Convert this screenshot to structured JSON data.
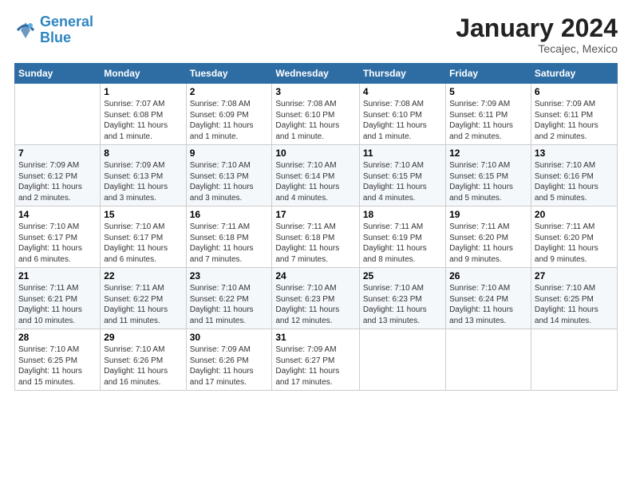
{
  "header": {
    "logo_line1": "General",
    "logo_line2": "Blue",
    "month_title": "January 2024",
    "location": "Tecajec, Mexico"
  },
  "weekdays": [
    "Sunday",
    "Monday",
    "Tuesday",
    "Wednesday",
    "Thursday",
    "Friday",
    "Saturday"
  ],
  "weeks": [
    [
      {
        "day": "",
        "info": ""
      },
      {
        "day": "1",
        "info": "Sunrise: 7:07 AM\nSunset: 6:08 PM\nDaylight: 11 hours\nand 1 minute."
      },
      {
        "day": "2",
        "info": "Sunrise: 7:08 AM\nSunset: 6:09 PM\nDaylight: 11 hours\nand 1 minute."
      },
      {
        "day": "3",
        "info": "Sunrise: 7:08 AM\nSunset: 6:10 PM\nDaylight: 11 hours\nand 1 minute."
      },
      {
        "day": "4",
        "info": "Sunrise: 7:08 AM\nSunset: 6:10 PM\nDaylight: 11 hours\nand 1 minute."
      },
      {
        "day": "5",
        "info": "Sunrise: 7:09 AM\nSunset: 6:11 PM\nDaylight: 11 hours\nand 2 minutes."
      },
      {
        "day": "6",
        "info": "Sunrise: 7:09 AM\nSunset: 6:11 PM\nDaylight: 11 hours\nand 2 minutes."
      }
    ],
    [
      {
        "day": "7",
        "info": "Sunrise: 7:09 AM\nSunset: 6:12 PM\nDaylight: 11 hours\nand 2 minutes."
      },
      {
        "day": "8",
        "info": "Sunrise: 7:09 AM\nSunset: 6:13 PM\nDaylight: 11 hours\nand 3 minutes."
      },
      {
        "day": "9",
        "info": "Sunrise: 7:10 AM\nSunset: 6:13 PM\nDaylight: 11 hours\nand 3 minutes."
      },
      {
        "day": "10",
        "info": "Sunrise: 7:10 AM\nSunset: 6:14 PM\nDaylight: 11 hours\nand 4 minutes."
      },
      {
        "day": "11",
        "info": "Sunrise: 7:10 AM\nSunset: 6:15 PM\nDaylight: 11 hours\nand 4 minutes."
      },
      {
        "day": "12",
        "info": "Sunrise: 7:10 AM\nSunset: 6:15 PM\nDaylight: 11 hours\nand 5 minutes."
      },
      {
        "day": "13",
        "info": "Sunrise: 7:10 AM\nSunset: 6:16 PM\nDaylight: 11 hours\nand 5 minutes."
      }
    ],
    [
      {
        "day": "14",
        "info": "Sunrise: 7:10 AM\nSunset: 6:17 PM\nDaylight: 11 hours\nand 6 minutes."
      },
      {
        "day": "15",
        "info": "Sunrise: 7:10 AM\nSunset: 6:17 PM\nDaylight: 11 hours\nand 6 minutes."
      },
      {
        "day": "16",
        "info": "Sunrise: 7:11 AM\nSunset: 6:18 PM\nDaylight: 11 hours\nand 7 minutes."
      },
      {
        "day": "17",
        "info": "Sunrise: 7:11 AM\nSunset: 6:18 PM\nDaylight: 11 hours\nand 7 minutes."
      },
      {
        "day": "18",
        "info": "Sunrise: 7:11 AM\nSunset: 6:19 PM\nDaylight: 11 hours\nand 8 minutes."
      },
      {
        "day": "19",
        "info": "Sunrise: 7:11 AM\nSunset: 6:20 PM\nDaylight: 11 hours\nand 9 minutes."
      },
      {
        "day": "20",
        "info": "Sunrise: 7:11 AM\nSunset: 6:20 PM\nDaylight: 11 hours\nand 9 minutes."
      }
    ],
    [
      {
        "day": "21",
        "info": "Sunrise: 7:11 AM\nSunset: 6:21 PM\nDaylight: 11 hours\nand 10 minutes."
      },
      {
        "day": "22",
        "info": "Sunrise: 7:11 AM\nSunset: 6:22 PM\nDaylight: 11 hours\nand 11 minutes."
      },
      {
        "day": "23",
        "info": "Sunrise: 7:10 AM\nSunset: 6:22 PM\nDaylight: 11 hours\nand 11 minutes."
      },
      {
        "day": "24",
        "info": "Sunrise: 7:10 AM\nSunset: 6:23 PM\nDaylight: 11 hours\nand 12 minutes."
      },
      {
        "day": "25",
        "info": "Sunrise: 7:10 AM\nSunset: 6:23 PM\nDaylight: 11 hours\nand 13 minutes."
      },
      {
        "day": "26",
        "info": "Sunrise: 7:10 AM\nSunset: 6:24 PM\nDaylight: 11 hours\nand 13 minutes."
      },
      {
        "day": "27",
        "info": "Sunrise: 7:10 AM\nSunset: 6:25 PM\nDaylight: 11 hours\nand 14 minutes."
      }
    ],
    [
      {
        "day": "28",
        "info": "Sunrise: 7:10 AM\nSunset: 6:25 PM\nDaylight: 11 hours\nand 15 minutes."
      },
      {
        "day": "29",
        "info": "Sunrise: 7:10 AM\nSunset: 6:26 PM\nDaylight: 11 hours\nand 16 minutes."
      },
      {
        "day": "30",
        "info": "Sunrise: 7:09 AM\nSunset: 6:26 PM\nDaylight: 11 hours\nand 17 minutes."
      },
      {
        "day": "31",
        "info": "Sunrise: 7:09 AM\nSunset: 6:27 PM\nDaylight: 11 hours\nand 17 minutes."
      },
      {
        "day": "",
        "info": ""
      },
      {
        "day": "",
        "info": ""
      },
      {
        "day": "",
        "info": ""
      }
    ]
  ]
}
